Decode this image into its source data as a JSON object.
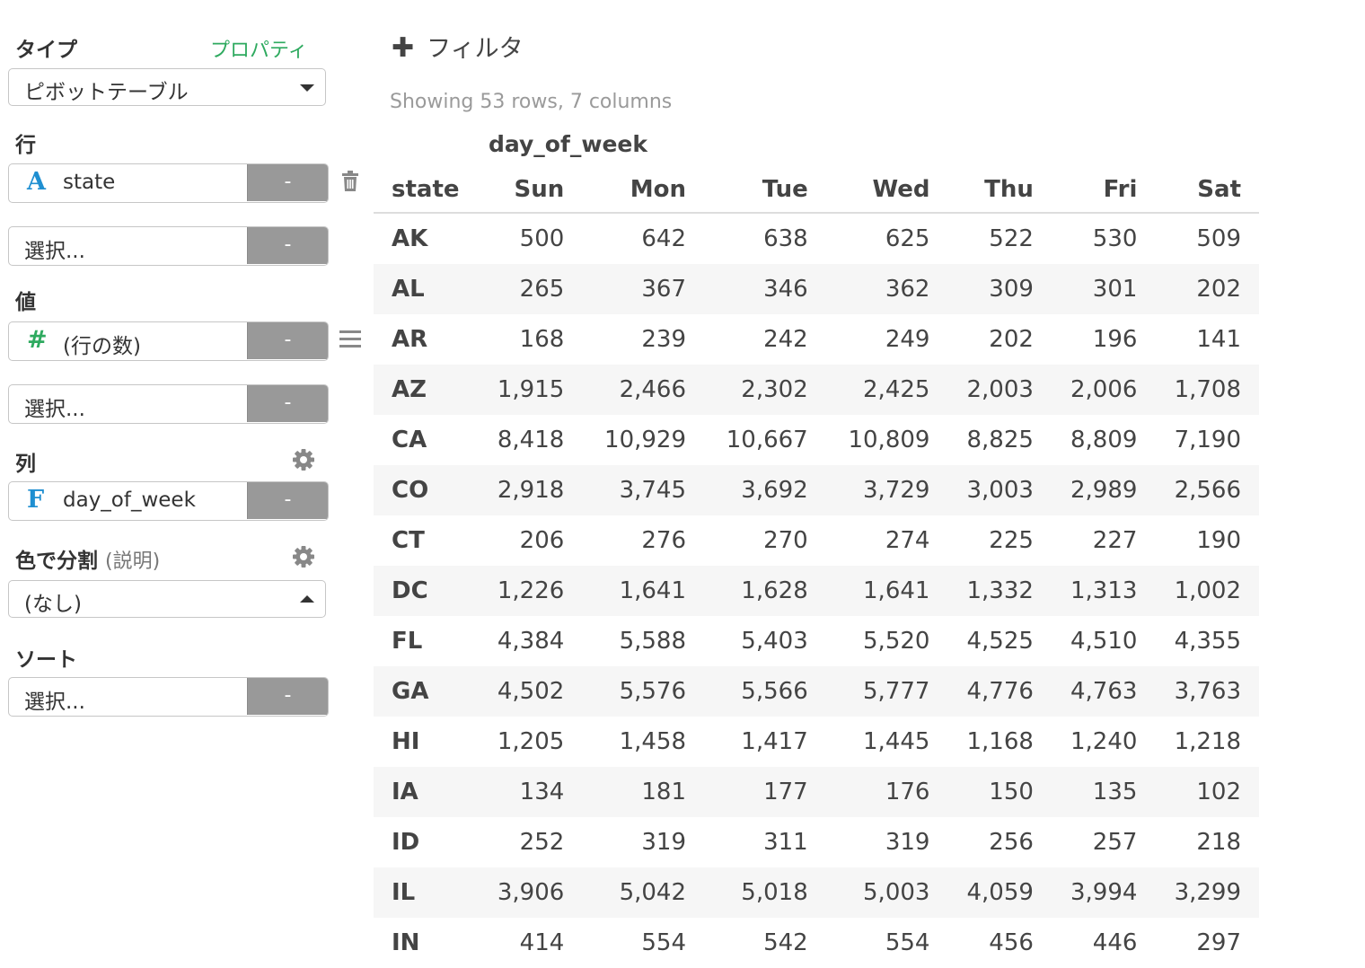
{
  "sidebar": {
    "type_label": "タイプ",
    "properties_link": "プロパティ",
    "type_value": "ピボットテーブル",
    "rows_label": "行",
    "row_field": {
      "type_icon": "A",
      "name": "state"
    },
    "values_label": "値",
    "value_field": {
      "type_icon": "#",
      "name": "(行の数)"
    },
    "columns_label": "列",
    "column_field": {
      "type_icon": "F",
      "name": "day_of_week"
    },
    "color_label": "色で分割",
    "color_sub": "(説明)",
    "color_value": "(なし)",
    "sort_label": "ソート",
    "select_placeholder": "選択...",
    "minus_label": "-"
  },
  "main": {
    "filter_label": "フィルタ",
    "summary": "Showing 53 rows, 7 columns",
    "column_group": "day_of_week",
    "row_header": "state",
    "columns": [
      "Sun",
      "Mon",
      "Tue",
      "Wed",
      "Thu",
      "Fri",
      "Sat"
    ],
    "rows": [
      {
        "state": "AK",
        "values": [
          "500",
          "642",
          "638",
          "625",
          "522",
          "530",
          "509"
        ]
      },
      {
        "state": "AL",
        "values": [
          "265",
          "367",
          "346",
          "362",
          "309",
          "301",
          "202"
        ]
      },
      {
        "state": "AR",
        "values": [
          "168",
          "239",
          "242",
          "249",
          "202",
          "196",
          "141"
        ]
      },
      {
        "state": "AZ",
        "values": [
          "1,915",
          "2,466",
          "2,302",
          "2,425",
          "2,003",
          "2,006",
          "1,708"
        ]
      },
      {
        "state": "CA",
        "values": [
          "8,418",
          "10,929",
          "10,667",
          "10,809",
          "8,825",
          "8,809",
          "7,190"
        ]
      },
      {
        "state": "CO",
        "values": [
          "2,918",
          "3,745",
          "3,692",
          "3,729",
          "3,003",
          "2,989",
          "2,566"
        ]
      },
      {
        "state": "CT",
        "values": [
          "206",
          "276",
          "270",
          "274",
          "225",
          "227",
          "190"
        ]
      },
      {
        "state": "DC",
        "values": [
          "1,226",
          "1,641",
          "1,628",
          "1,641",
          "1,332",
          "1,313",
          "1,002"
        ]
      },
      {
        "state": "FL",
        "values": [
          "4,384",
          "5,588",
          "5,403",
          "5,520",
          "4,525",
          "4,510",
          "4,355"
        ]
      },
      {
        "state": "GA",
        "values": [
          "4,502",
          "5,576",
          "5,566",
          "5,777",
          "4,776",
          "4,763",
          "3,763"
        ]
      },
      {
        "state": "HI",
        "values": [
          "1,205",
          "1,458",
          "1,417",
          "1,445",
          "1,168",
          "1,240",
          "1,218"
        ]
      },
      {
        "state": "IA",
        "values": [
          "134",
          "181",
          "177",
          "176",
          "150",
          "135",
          "102"
        ]
      },
      {
        "state": "ID",
        "values": [
          "252",
          "319",
          "311",
          "319",
          "256",
          "257",
          "218"
        ]
      },
      {
        "state": "IL",
        "values": [
          "3,906",
          "5,042",
          "5,018",
          "5,003",
          "4,059",
          "3,994",
          "3,299"
        ]
      },
      {
        "state": "IN",
        "values": [
          "414",
          "554",
          "542",
          "554",
          "456",
          "446",
          "297"
        ]
      }
    ]
  },
  "icons": {
    "plus": "plus-icon",
    "trash": "trash-icon",
    "menu": "menu-icon",
    "gear": "gear-icon",
    "caret_down": "chevron-down-icon",
    "caret_up": "chevron-up-icon"
  },
  "colors": {
    "accent_green": "#2eaa5f",
    "type_blue": "#1f8fd1",
    "minus_button": "#999999",
    "stripe": "#f6f6f6"
  }
}
